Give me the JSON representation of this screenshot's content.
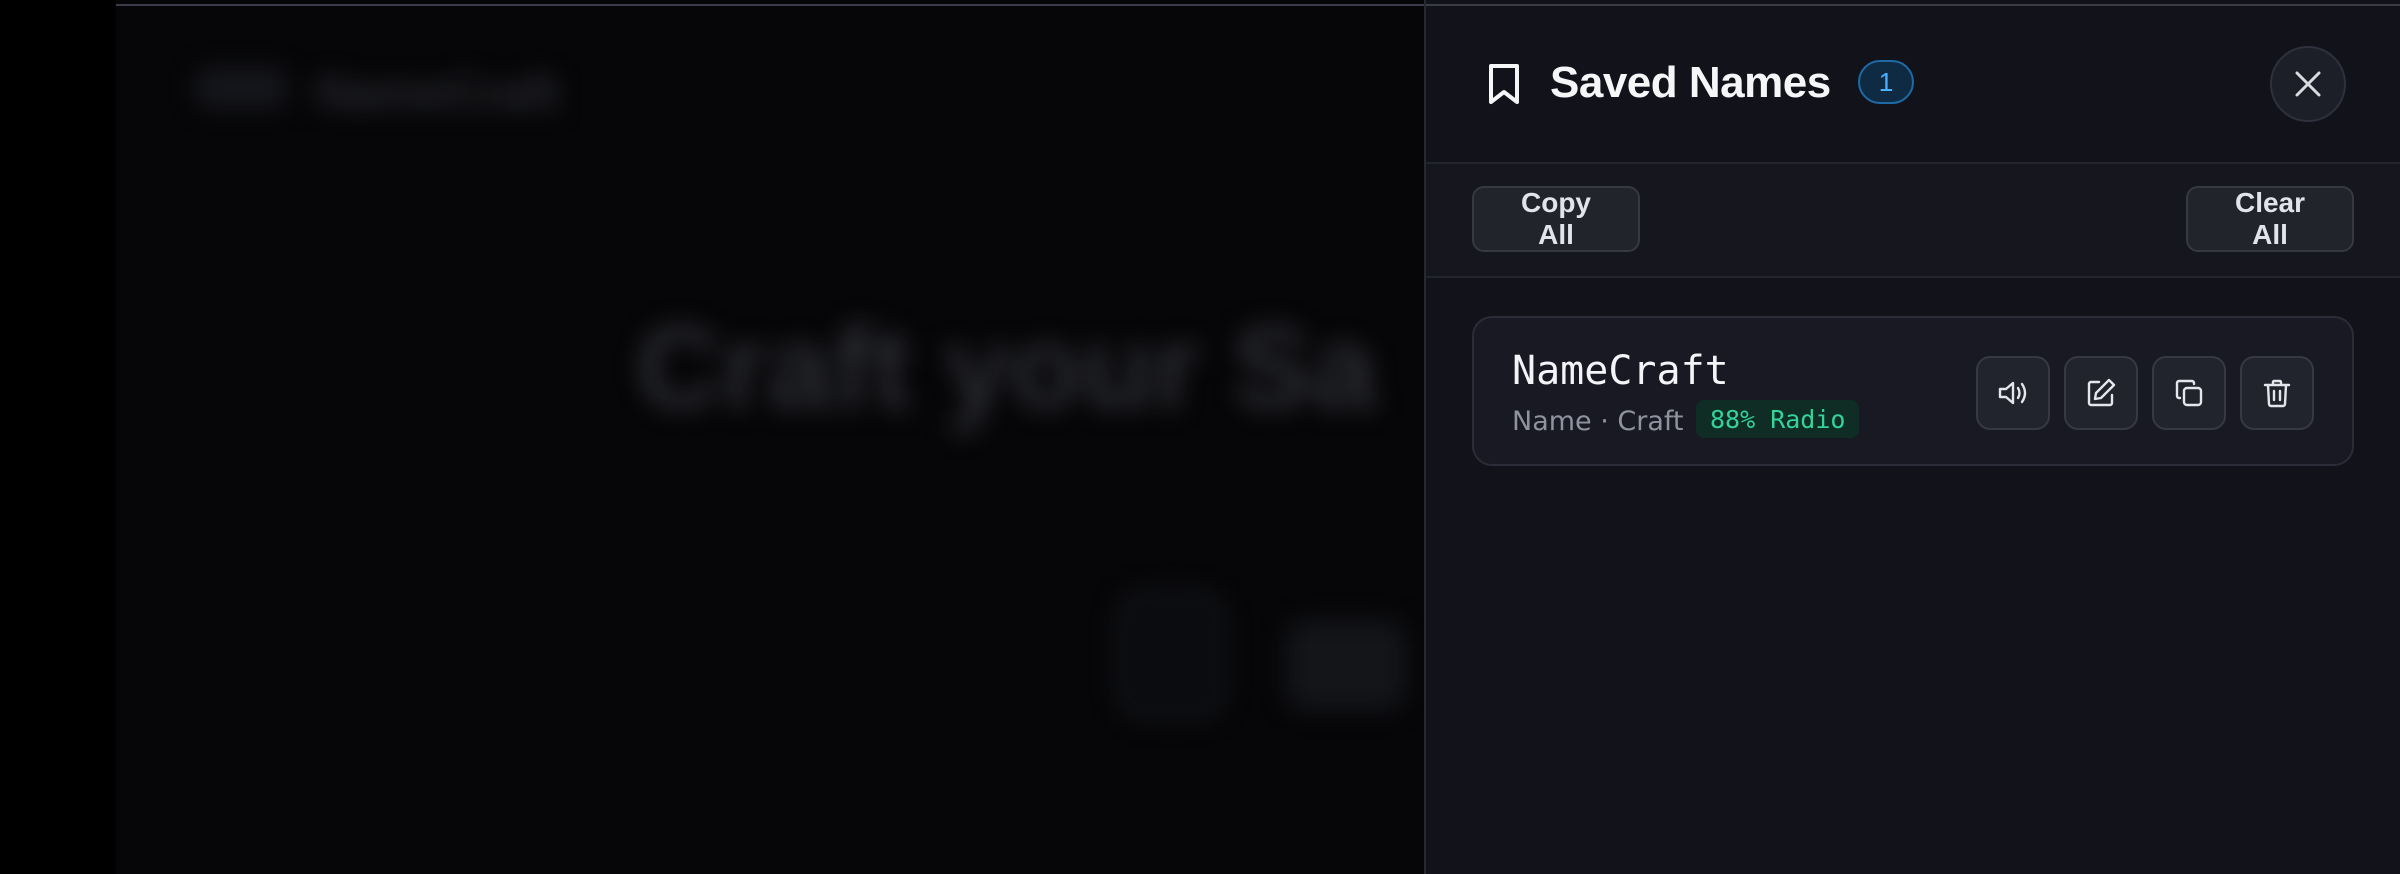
{
  "background": {
    "logo_text": "NameCraft",
    "headline": "Craft your Sa"
  },
  "drawer": {
    "title": "Saved Names",
    "count": "1",
    "close_icon": "close-icon",
    "bookmark_icon": "bookmark-icon",
    "toolbar": {
      "copy_all_label": "Copy All",
      "clear_all_label": "Clear All"
    },
    "items": [
      {
        "name": "NameCraft",
        "parts": "Name · Craft",
        "score": "88% Radio",
        "actions": [
          "speaker-icon",
          "edit-icon",
          "copy-icon",
          "trash-icon"
        ]
      }
    ]
  },
  "colors": {
    "drawer_bg": "#11121a",
    "badge_blue": "#49b1ff",
    "score_green": "#33d399"
  }
}
